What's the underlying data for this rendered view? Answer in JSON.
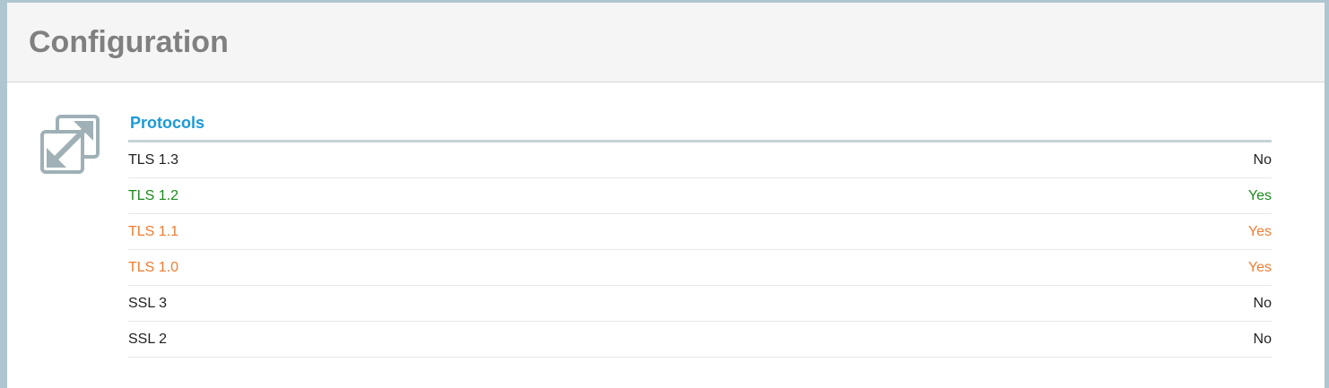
{
  "section": {
    "title": "Configuration"
  },
  "icons": {
    "protocols": "expand-arrows-icon"
  },
  "colors": {
    "title_gray": "#808080",
    "accent_blue": "#1a9ad6",
    "ok_green": "#1c8a1c",
    "warning_orange": "#ef7d33",
    "neutral": "#222222",
    "border": "#aec6cf"
  },
  "protocols": {
    "title": "Protocols",
    "rows": [
      {
        "name": "TLS 1.3",
        "value": "No",
        "status": "neutral"
      },
      {
        "name": "TLS 1.2",
        "value": "Yes",
        "status": "good"
      },
      {
        "name": "TLS 1.1",
        "value": "Yes",
        "status": "warn"
      },
      {
        "name": "TLS 1.0",
        "value": "Yes",
        "status": "warn"
      },
      {
        "name": "SSL 3",
        "value": "No",
        "status": "neutral"
      },
      {
        "name": "SSL 2",
        "value": "No",
        "status": "neutral"
      }
    ]
  }
}
